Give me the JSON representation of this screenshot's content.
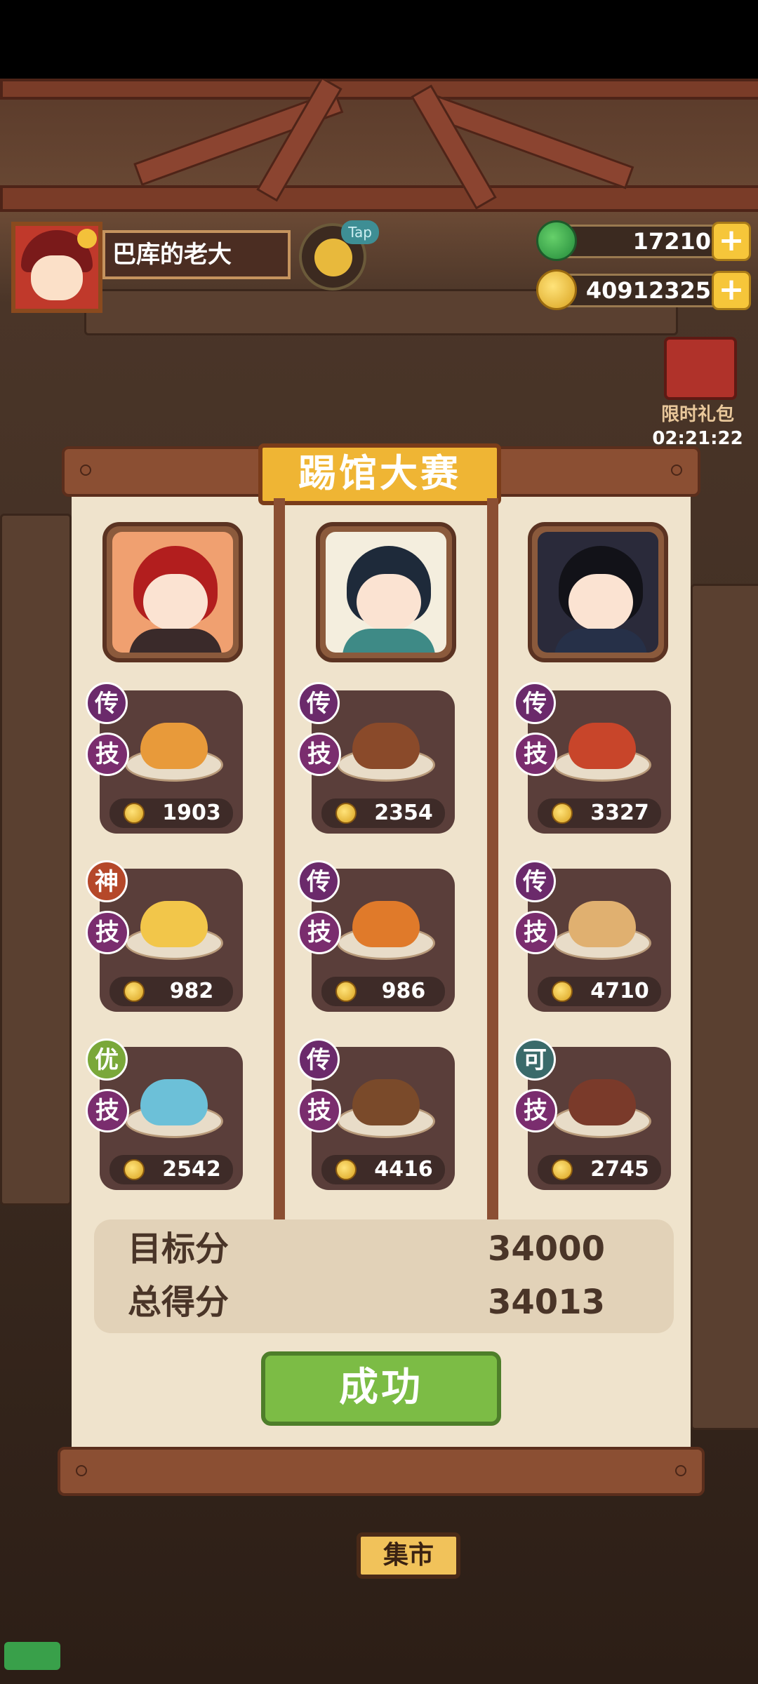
{
  "player": {
    "name": "巴库的老大",
    "tap_label": "Tap"
  },
  "currency": {
    "jade": "17210",
    "coins": "40912325",
    "plus": "+"
  },
  "gift": {
    "label": "限时礼包",
    "timer": "02:21:22"
  },
  "modal": {
    "title": "踢馆大赛",
    "columns": [
      {
        "dishes": [
          {
            "tier": "传",
            "tier_color": "#6b2a6b",
            "skill": "技",
            "value": "1903",
            "food_color": "#e89a3a"
          },
          {
            "tier": "神",
            "tier_color": "#b5482a",
            "skill": "技",
            "value": "982",
            "food_color": "#f2c64a"
          },
          {
            "tier": "优",
            "tier_color": "#7aa83a",
            "skill": "技",
            "value": "2542",
            "food_color": "#6cc0d8"
          }
        ]
      },
      {
        "dishes": [
          {
            "tier": "传",
            "tier_color": "#6b2a6b",
            "skill": "技",
            "value": "2354",
            "food_color": "#8a4a2a"
          },
          {
            "tier": "传",
            "tier_color": "#6b2a6b",
            "skill": "技",
            "value": "986",
            "food_color": "#e07a2a"
          },
          {
            "tier": "传",
            "tier_color": "#6b2a6b",
            "skill": "技",
            "value": "4416",
            "food_color": "#7a4a2a"
          }
        ]
      },
      {
        "dishes": [
          {
            "tier": "传",
            "tier_color": "#6b2a6b",
            "skill": "技",
            "value": "3327",
            "food_color": "#c8452a"
          },
          {
            "tier": "传",
            "tier_color": "#6b2a6b",
            "skill": "技",
            "value": "4710",
            "food_color": "#e0b070"
          },
          {
            "tier": "可",
            "tier_color": "#3a6a6a",
            "skill": "技",
            "value": "2745",
            "food_color": "#7a3a2a"
          }
        ]
      }
    ],
    "target_label": "目标分",
    "target_value": "34000",
    "total_label": "总得分",
    "total_value": "34013",
    "success_label": "成功"
  },
  "scene": {
    "market_label": "集市"
  }
}
